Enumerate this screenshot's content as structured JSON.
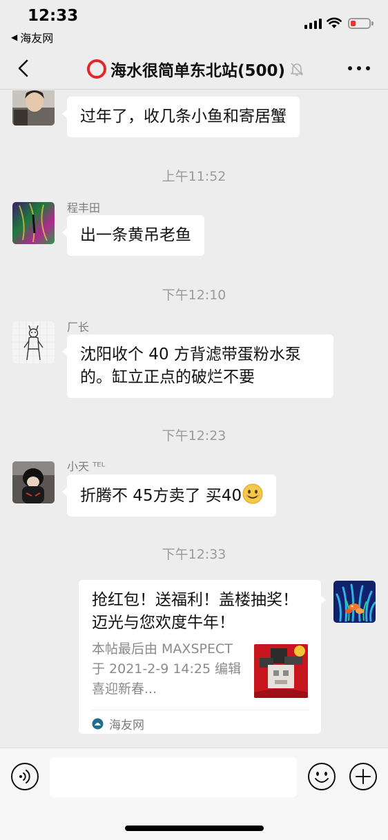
{
  "status_bar": {
    "time": "12:33",
    "back_app": "海友网",
    "back_arrow": "◀",
    "battery_color": "#e8332e"
  },
  "nav": {
    "title": "海水很简单东北站(500)",
    "title_prefix_icon": "red-ring-icon",
    "mute_icon": "bell-muted-icon",
    "more_icon": "more-dots-icon",
    "back_icon": "chevron-left-icon"
  },
  "messages": [
    {
      "type": "bubble",
      "text": "过年了，收几条小鱼和寄居蟹"
    },
    {
      "type": "timestamp",
      "text": "上午11:52"
    },
    {
      "type": "bubble",
      "sender": "程丰田",
      "text": "出一条黄吊老鱼"
    },
    {
      "type": "timestamp",
      "text": "下午12:10"
    },
    {
      "type": "bubble",
      "sender": "厂长",
      "text": "沈阳收个 40 方背滤带蛋粉水泵的。缸立正点的破烂不要"
    },
    {
      "type": "timestamp",
      "text": "下午12:23"
    },
    {
      "type": "bubble",
      "sender": "小天 ᵀᴱᴸ",
      "text": "折腾不 45方卖了 买40",
      "emoji": "smiling-face-emoji"
    },
    {
      "type": "timestamp",
      "text": "下午12:33"
    }
  ],
  "card": {
    "title": "抢红包！送福利！盖楼抽奖！迈光与您欢度牛年！",
    "description": "本帖最后由 MAXSPECT 于 2021-2-9 14:25 编辑 喜迎新春...",
    "source": "海友网",
    "source_icon": "haiyou-logo-icon"
  },
  "input_bar": {
    "placeholder": "",
    "voice_icon": "voice-icon",
    "emoji_icon": "emoji-icon",
    "plus_icon": "plus-icon"
  },
  "colors": {
    "background": "#ededed",
    "bubble": "#ffffff",
    "timestamp": "#9a9a9a",
    "red_accent": "#e0282a"
  }
}
